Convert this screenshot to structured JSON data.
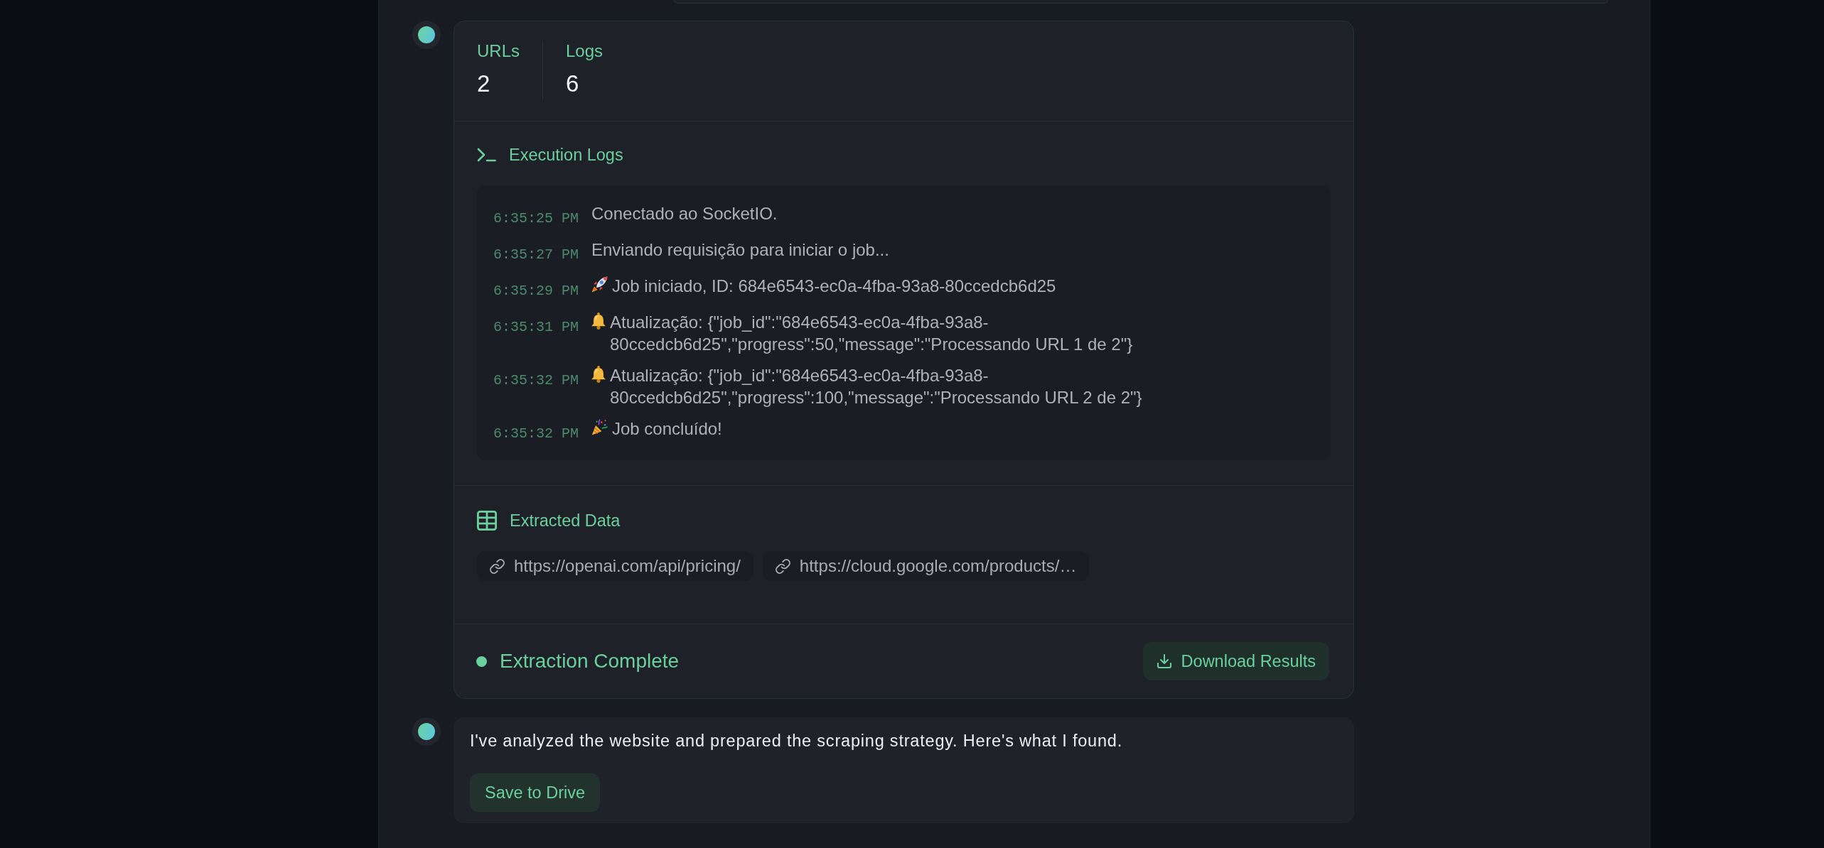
{
  "messages": [
    {
      "kind": "report",
      "stats": [
        {
          "label": "URLs",
          "value": "2"
        },
        {
          "label": "Logs",
          "value": "6"
        }
      ],
      "logs": {
        "title": "Execution Logs",
        "entries": [
          {
            "time": "6:35:25 PM",
            "kind": "info",
            "text": "Conectado ao SocketIO."
          },
          {
            "time": "6:35:27 PM",
            "kind": "info",
            "text": "Enviando requisição para iniciar o job..."
          },
          {
            "time": "6:35:29 PM",
            "kind": "start",
            "text": "Job iniciado, ID: 684e6543-ec0a-4fba-93a8-80ccedcb6d25"
          },
          {
            "time": "6:35:31 PM",
            "kind": "update",
            "text": "Atualização: {\"job_id\":\"684e6543-ec0a-4fba-93a8-80ccedcb6d25\",\"progress\":50,\"message\":\"Processando URL 1 de 2\"}"
          },
          {
            "time": "6:35:32 PM",
            "kind": "update",
            "text": "Atualização: {\"job_id\":\"684e6543-ec0a-4fba-93a8-80ccedcb6d25\",\"progress\":100,\"message\":\"Processando URL 2 de 2\"}"
          },
          {
            "time": "6:35:32 PM",
            "kind": "done",
            "text": "Job concluído!"
          }
        ]
      },
      "extracted": {
        "title": "Extracted Data",
        "urls": [
          "https://openai.com/api/pricing/",
          "https://cloud.google.com/products/…"
        ]
      },
      "status": {
        "label": "Extraction Complete",
        "action": "Download Results"
      }
    },
    {
      "kind": "text",
      "text": "I've analyzed the website and prepared the scraping strategy. Here's what I found.",
      "action": "Save to Drive"
    }
  ]
}
